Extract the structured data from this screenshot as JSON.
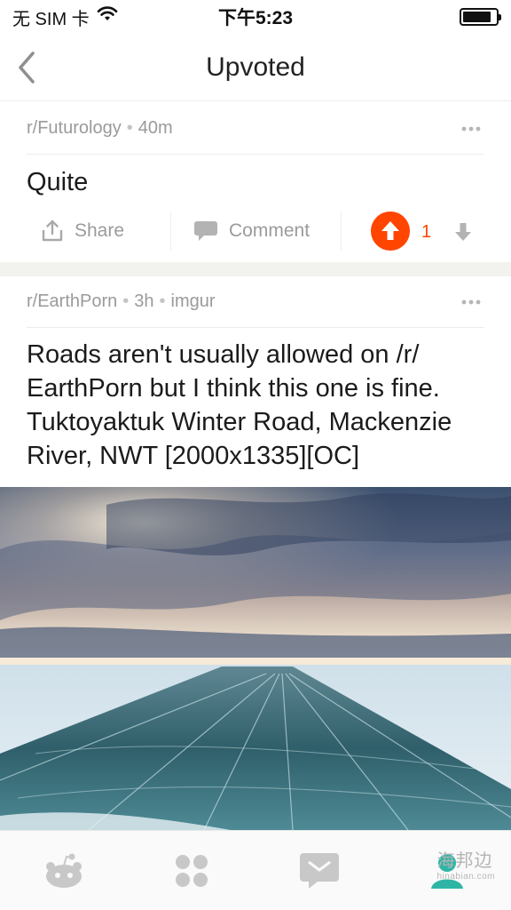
{
  "status_bar": {
    "carrier": "无 SIM 卡",
    "time": "下午5:23",
    "battery_level": 0.85,
    "wifi_icon": "wifi-icon",
    "battery_icon": "battery-icon"
  },
  "nav": {
    "title": "Upvoted",
    "back_icon": "chevron-left-icon"
  },
  "posts": [
    {
      "subreddit": "r/Futurology",
      "age": "40m",
      "title": "Quite",
      "actions": {
        "share_label": "Share",
        "comment_label": "Comment",
        "score": "1",
        "upvoted": true
      }
    },
    {
      "subreddit": "r/EarthPorn",
      "age": "3h",
      "domain": "imgur",
      "title": "Roads aren't usually allowed on /r/ EarthPorn but I think this one is fine. Tuktoyaktuk Winter Road, Mackenzie River, NWT [2000x1335][OC]",
      "image_icon": "photo-ice-road"
    }
  ],
  "tab_bar": {
    "items": [
      "home-reddit-icon",
      "apps-grid-icon",
      "inbox-message-icon",
      "profile-icon"
    ]
  },
  "watermark": {
    "text": "海邦边",
    "url": "hinabian.com"
  },
  "colors": {
    "accent": "#ff4500",
    "muted_text": "#9a9a9a",
    "divider": "#f2f2ef"
  }
}
